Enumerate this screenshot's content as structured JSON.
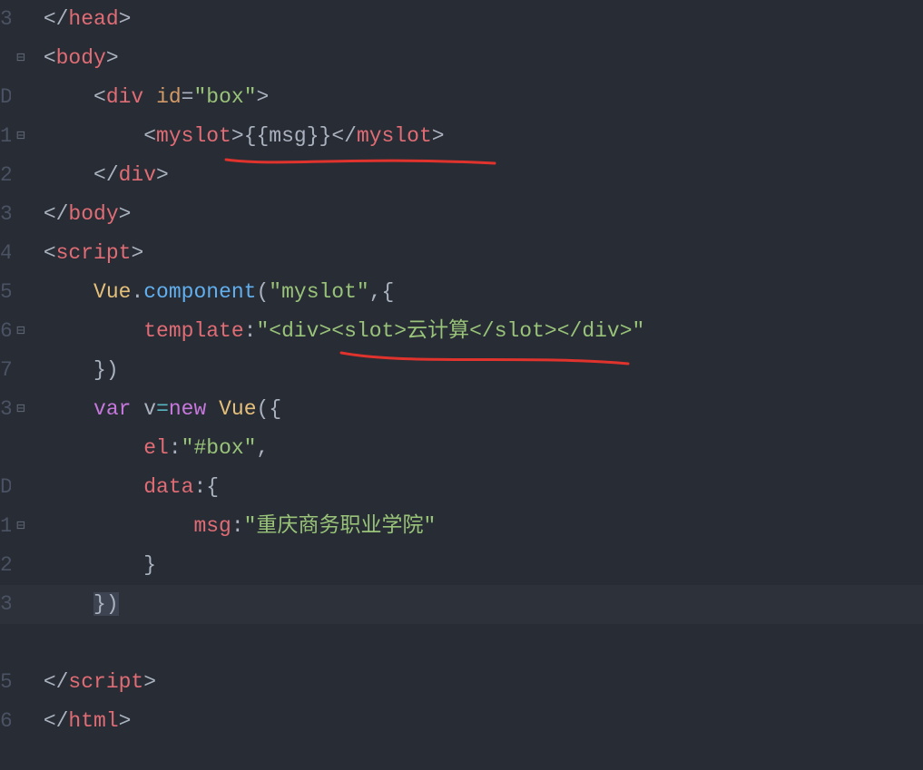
{
  "lineNumbers": [
    "3",
    "",
    "D",
    "1",
    "2",
    "3",
    "4",
    "5",
    "6",
    "7",
    "3",
    "",
    "D",
    "1",
    "2",
    "3",
    "",
    "5",
    "6"
  ],
  "foldMarks": [
    "",
    "⊟",
    "",
    "⊟",
    "",
    "",
    "",
    "",
    "⊟",
    "",
    "⊟",
    "",
    "",
    "⊟",
    "",
    "",
    "",
    "",
    ""
  ],
  "code": {
    "l0": {
      "closeHead": "head"
    },
    "l1": {
      "body": "body"
    },
    "l2": {
      "div": "div",
      "id": "id",
      "eq": "=",
      "box": "\"box\""
    },
    "l3": {
      "myslot": "myslot",
      "mustacheL": "{{",
      "msg": "msg",
      "mustacheR": "}}"
    },
    "l4": {
      "div": "div"
    },
    "l5": {
      "body": "body"
    },
    "l6": {
      "script": "script"
    },
    "l7": {
      "Vue": "Vue",
      "dot": ".",
      "component": "component",
      "lp": "(",
      "str": "\"myslot\"",
      "comma": ",",
      "lb": "{"
    },
    "l8": {
      "template": "template",
      "colon": ":",
      "str": "\"<div><slot>云计算</slot></div>\""
    },
    "l9": {
      "rb": "}",
      "rp": ")"
    },
    "l10": {
      "var": "var",
      "v": "v",
      "eq": "=",
      "new": "new",
      "Vue": "Vue",
      "lp": "(",
      "lb": "{"
    },
    "l11": {
      "el": "el",
      "colon": ":",
      "str": "\"#box\"",
      "comma": ","
    },
    "l12": {
      "data": "data",
      "colon": ":",
      "lb": "{"
    },
    "l13": {
      "msg": "msg",
      "colon": ":",
      "str": "\"重庆商务职业学院\""
    },
    "l14": {
      "rb": "}"
    },
    "l15": {
      "rb": "}",
      "rp": ")"
    },
    "l16": {},
    "l17": {
      "script": "script"
    },
    "l18": {
      "html": "html"
    }
  }
}
